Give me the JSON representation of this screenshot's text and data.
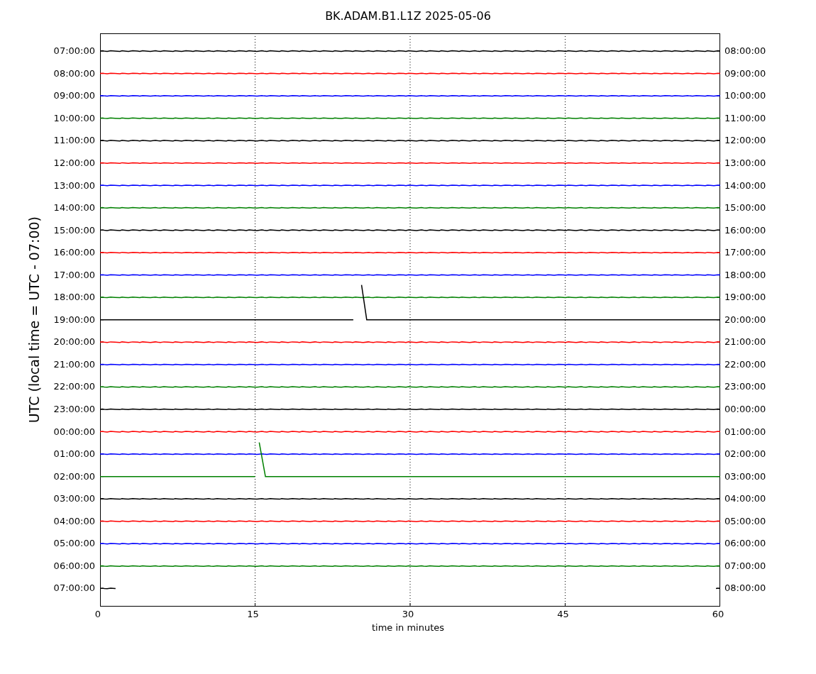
{
  "title": "BK.ADAM.B1.L1Z 2025-05-06",
  "ylabel": "UTC (local time = UTC - 07:00)",
  "xlabel": "time in minutes",
  "xticks": [
    "0",
    "15",
    "30",
    "45",
    "60"
  ],
  "traces": [
    {
      "left": "07:00:00",
      "right": "08:00:00",
      "color": "#000000",
      "kind": "flat"
    },
    {
      "left": "08:00:00",
      "right": "09:00:00",
      "color": "#ff0000",
      "kind": "flat"
    },
    {
      "left": "09:00:00",
      "right": "10:00:00",
      "color": "#0000ff",
      "kind": "flat"
    },
    {
      "left": "10:00:00",
      "right": "11:00:00",
      "color": "#008000",
      "kind": "flat"
    },
    {
      "left": "11:00:00",
      "right": "12:00:00",
      "color": "#000000",
      "kind": "flat"
    },
    {
      "left": "12:00:00",
      "right": "13:00:00",
      "color": "#ff0000",
      "kind": "flat"
    },
    {
      "left": "13:00:00",
      "right": "14:00:00",
      "color": "#0000ff",
      "kind": "flat"
    },
    {
      "left": "14:00:00",
      "right": "15:00:00",
      "color": "#008000",
      "kind": "flat"
    },
    {
      "left": "15:00:00",
      "right": "16:00:00",
      "color": "#000000",
      "kind": "flat"
    },
    {
      "left": "16:00:00",
      "right": "17:00:00",
      "color": "#ff0000",
      "kind": "flat"
    },
    {
      "left": "17:00:00",
      "right": "18:00:00",
      "color": "#0000ff",
      "kind": "flat"
    },
    {
      "left": "18:00:00",
      "right": "19:00:00",
      "color": "#008000",
      "kind": "flat"
    },
    {
      "left": "19:00:00",
      "right": "20:00:00",
      "color": "#000000",
      "kind": "late-step"
    },
    {
      "left": "20:00:00",
      "right": "21:00:00",
      "color": "#ff0000",
      "kind": "flat"
    },
    {
      "left": "21:00:00",
      "right": "22:00:00",
      "color": "#0000ff",
      "kind": "flat"
    },
    {
      "left": "22:00:00",
      "right": "23:00:00",
      "color": "#008000",
      "kind": "flat"
    },
    {
      "left": "23:00:00",
      "right": "00:00:00",
      "color": "#000000",
      "kind": "flat"
    },
    {
      "left": "00:00:00",
      "right": "01:00:00",
      "color": "#ff0000",
      "kind": "flat"
    },
    {
      "left": "01:00:00",
      "right": "02:00:00",
      "color": "#0000ff",
      "kind": "flat"
    },
    {
      "left": "02:00:00",
      "right": "03:00:00",
      "color": "#008000",
      "kind": "early-step"
    },
    {
      "left": "03:00:00",
      "right": "04:00:00",
      "color": "#000000",
      "kind": "flat"
    },
    {
      "left": "04:00:00",
      "right": "05:00:00",
      "color": "#ff0000",
      "kind": "flat"
    },
    {
      "left": "05:00:00",
      "right": "06:00:00",
      "color": "#0000ff",
      "kind": "flat"
    },
    {
      "left": "06:00:00",
      "right": "07:00:00",
      "color": "#008000",
      "kind": "flat"
    },
    {
      "left": "07:00:00",
      "right": "08:00:00",
      "color": "#000000",
      "kind": "short"
    }
  ]
}
